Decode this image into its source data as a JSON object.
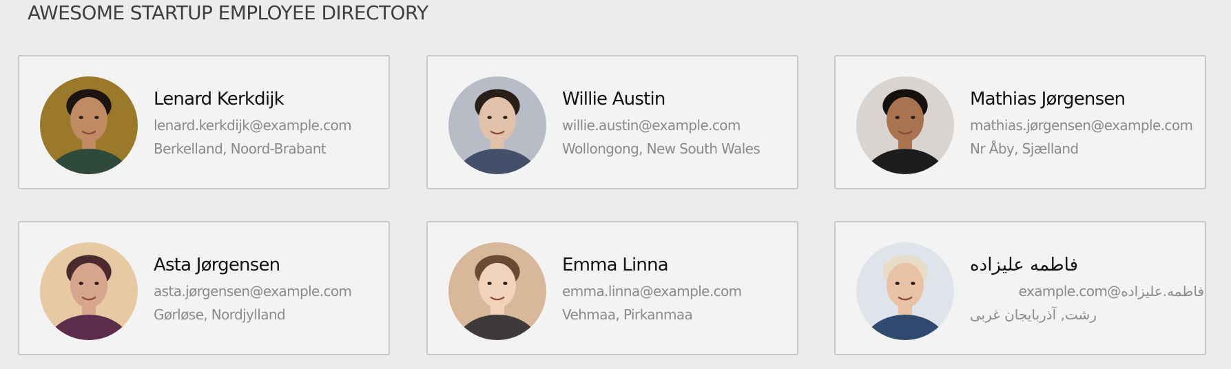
{
  "page": {
    "title": "AWESOME STARTUP EMPLOYEE DIRECTORY"
  },
  "employees": [
    {
      "name": "Lenard Kerkdijk",
      "email": "lenard.kerkdijk@example.com",
      "location": "Berkelland, Noord-Brabant",
      "avatar_icon": "person-avatar-icon",
      "avatar_colors": {
        "bg": "#9a7a2a",
        "skin": "#c08a62",
        "hair": "#1c1410",
        "shirt": "#2f4a3a"
      }
    },
    {
      "name": "Willie Austin",
      "email": "willie.austin@example.com",
      "location": "Wollongong, New South Wales",
      "avatar_icon": "person-avatar-icon",
      "avatar_colors": {
        "bg": "#b7bcc6",
        "skin": "#e2c1ab",
        "hair": "#2a1e19",
        "shirt": "#44506a"
      }
    },
    {
      "name": "Mathias Jørgensen",
      "email": "mathias.jørgensen@example.com",
      "location": "Nr Åby, Sjælland",
      "avatar_icon": "person-avatar-icon",
      "avatar_colors": {
        "bg": "#d9d4cf",
        "skin": "#a8734e",
        "hair": "#131010",
        "shirt": "#1d1d1f"
      }
    },
    {
      "name": "Asta Jørgensen",
      "email": "asta.jørgensen@example.com",
      "location": "Gørløse, Nordjylland",
      "avatar_icon": "person-avatar-icon",
      "avatar_colors": {
        "bg": "#e7c9a4",
        "skin": "#d7a48e",
        "hair": "#4a2a2c",
        "shirt": "#5c2d4a"
      }
    },
    {
      "name": "Emma Linna",
      "email": "emma.linna@example.com",
      "location": "Vehmaa, Pirkanmaa",
      "avatar_icon": "person-avatar-icon",
      "avatar_colors": {
        "bg": "#d9b79a",
        "skin": "#f1d2bb",
        "hair": "#6a4a33",
        "shirt": "#3f3a3a"
      }
    },
    {
      "name": "فاطمه علیزاده",
      "email": "فاطمه.علیزاده@example.com",
      "location": "رشت, آذربایجان غربی",
      "avatar_icon": "person-avatar-icon",
      "avatar_colors": {
        "bg": "#dfe4ea",
        "skin": "#e9c2a6",
        "hair": "#e7dcc6",
        "shirt": "#2f4a6e"
      }
    }
  ]
}
